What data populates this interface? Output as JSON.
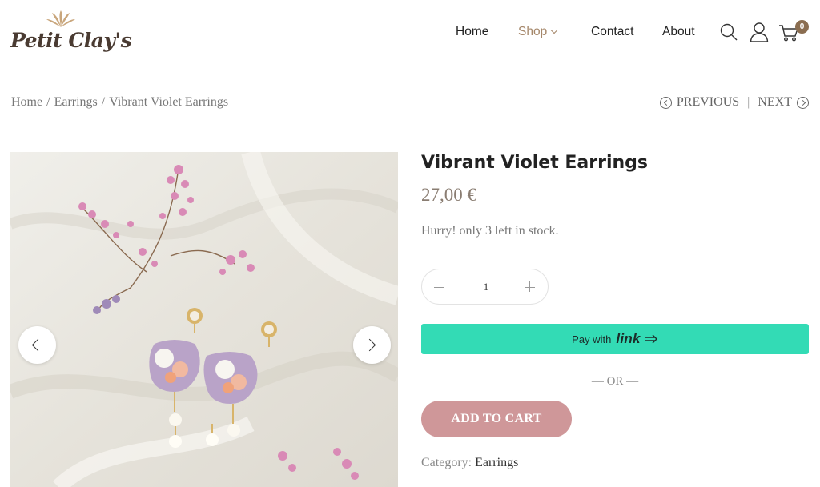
{
  "header": {
    "logo_text": "Petit Clay's",
    "nav": [
      {
        "label": "Home"
      },
      {
        "label": "Shop"
      },
      {
        "label": "Contact"
      },
      {
        "label": "About"
      }
    ],
    "icons": [
      "search-icon",
      "user-icon",
      "cart-icon"
    ],
    "cart_count": "0"
  },
  "breadcrumb": {
    "items": [
      "Home",
      "Earrings",
      "Vibrant Violet Earrings"
    ],
    "separator": "/"
  },
  "prevnext": {
    "prev": "PREVIOUS",
    "divider": "|",
    "next": "NEXT"
  },
  "product": {
    "title": "Vibrant Violet Earrings",
    "price": "27,00 €",
    "stock": "Hurry! only 3 left in stock.",
    "quantity": "1",
    "pay_with": "Pay with",
    "link_brand": "link",
    "or_text": "— OR —",
    "add_to_cart": "ADD TO CART",
    "category_label": "Category:",
    "category_value": "Earrings"
  },
  "colors": {
    "accent_brown": "#a5876a",
    "badge": "#8a6d50",
    "link_green": "#33dbb5",
    "add_cart_pink": "#cf9799"
  }
}
